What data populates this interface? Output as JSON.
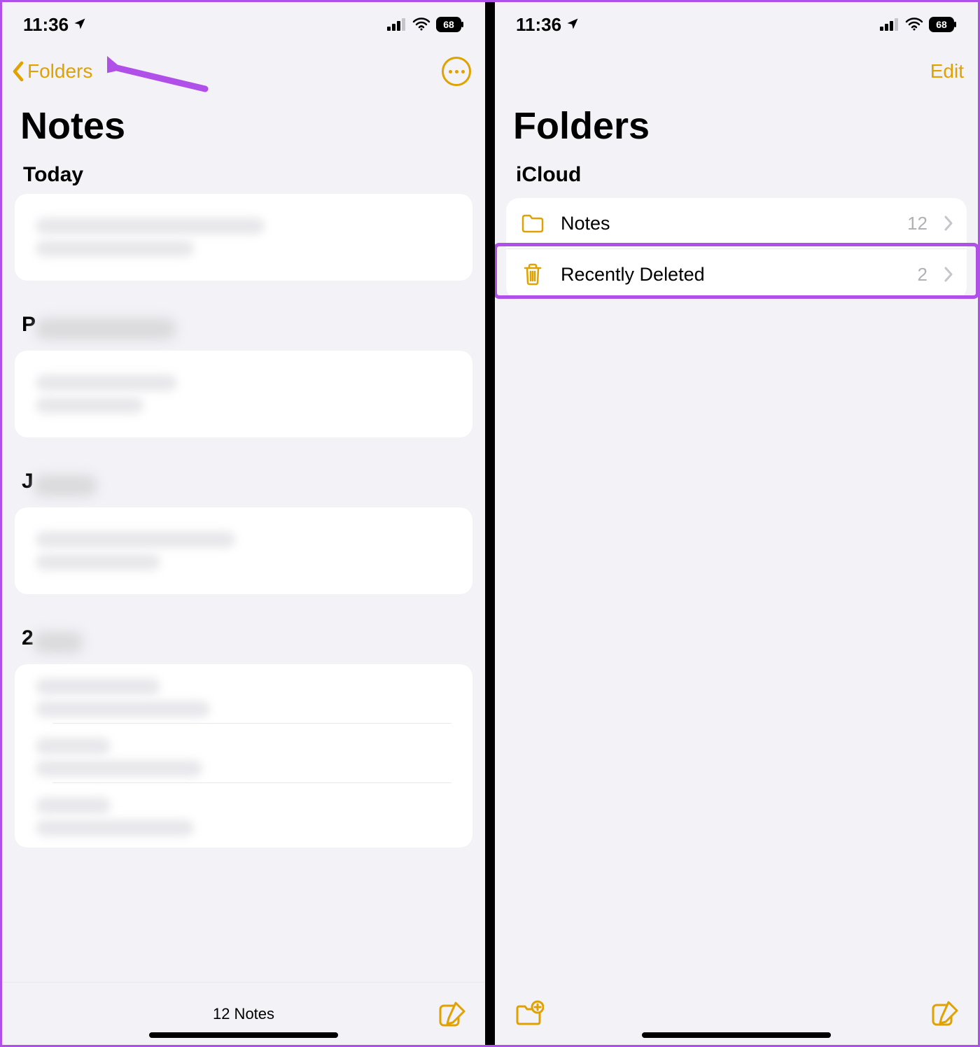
{
  "status": {
    "time": "11:36",
    "battery": "68"
  },
  "left": {
    "backLabel": "Folders",
    "title": "Notes",
    "sectionToday": "Today",
    "sectionP": "P",
    "sectionJ": "J",
    "section2": "2",
    "countLabel": "12 Notes"
  },
  "right": {
    "editLabel": "Edit",
    "title": "Folders",
    "section": "iCloud",
    "folders": [
      {
        "label": "Notes",
        "count": "12",
        "icon": "folder"
      },
      {
        "label": "Recently Deleted",
        "count": "2",
        "icon": "trash"
      }
    ]
  }
}
